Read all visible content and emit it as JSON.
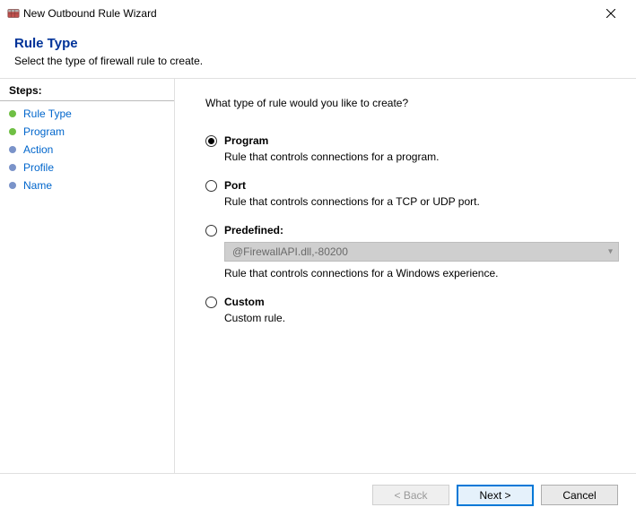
{
  "window": {
    "title": "New Outbound Rule Wizard"
  },
  "header": {
    "title": "Rule Type",
    "subtitle": "Select the type of firewall rule to create."
  },
  "sidebar": {
    "header": "Steps:",
    "items": [
      {
        "label": "Rule Type",
        "state": "current"
      },
      {
        "label": "Program",
        "state": "current"
      },
      {
        "label": "Action",
        "state": "pending"
      },
      {
        "label": "Profile",
        "state": "pending"
      },
      {
        "label": "Name",
        "state": "pending"
      }
    ]
  },
  "content": {
    "prompt": "What type of rule would you like to create?",
    "options": [
      {
        "key": "program",
        "label": "Program",
        "desc": "Rule that controls connections for a program.",
        "selected": true
      },
      {
        "key": "port",
        "label": "Port",
        "desc": "Rule that controls connections for a TCP or UDP port.",
        "selected": false
      },
      {
        "key": "predefined",
        "label": "Predefined:",
        "desc": "Rule that controls connections for a Windows experience.",
        "selected": false,
        "dropdown": "@FirewallAPI.dll,-80200"
      },
      {
        "key": "custom",
        "label": "Custom",
        "desc": "Custom rule.",
        "selected": false
      }
    ]
  },
  "footer": {
    "back": "< Back",
    "next": "Next >",
    "cancel": "Cancel"
  }
}
